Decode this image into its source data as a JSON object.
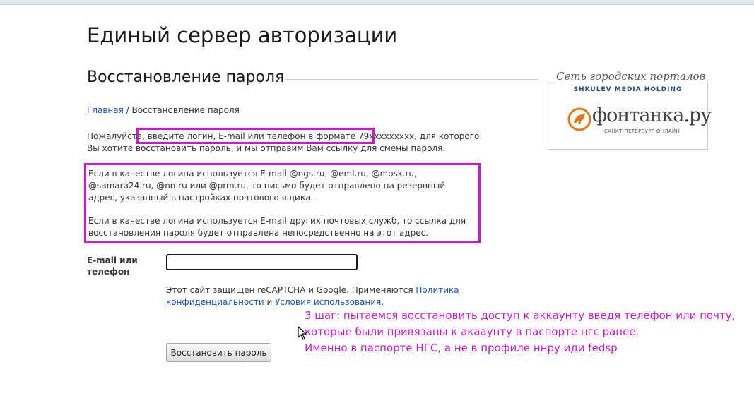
{
  "site": {
    "title": "Единый сервер авторизации"
  },
  "page": {
    "section_title": "Восстановление пароля"
  },
  "breadcrumb": {
    "home": "Главная",
    "separator": " / ",
    "current": "Восстановление пароля"
  },
  "intro": {
    "before": "Пожалуйста, ",
    "highlight": "введите логин, E-mail или телефон в формате 79xxxxxxxxx,",
    "after": " для которого Вы хотите восстановить пароль, и мы отправим Вам ссылку для смены пароля."
  },
  "info": {
    "paragraph1": "Если в качестве логина используется E-mail @ngs.ru, @eml.ru, @mosk.ru, @samara24.ru, @nn.ru или @prm.ru, то письмо будет отправлено на резервный адрес, указанный в настройках почтового ящика.",
    "paragraph2": "Если в качестве логина используется E-mail других почтовых служб, то ссылка для восстановления пароля будет отправлена непосредственно на этот адрес."
  },
  "form": {
    "label": "E-mail или телефон",
    "value": "",
    "placeholder": "",
    "recaptcha_before": "Этот сайт защищен reCAPTCHA и Google. Применяются ",
    "privacy_link": "Политика конфиденциальности",
    "recaptcha_and": " и ",
    "terms_link": "Условия использования",
    "recaptcha_end": ".",
    "submit": "Восстановить пароль"
  },
  "annotation": {
    "line1": "3 шаг: пытаемся восстановить доступ к аккаунту введя телефон или почту,",
    "line2": "которые были привязаны к акааунту в паспорте нгс ранее.",
    "line3": "Именно в паспорте НГС, а не в профиле ннру иди fedsp"
  },
  "logo": {
    "tagline": "Сеть городских порталов",
    "holding": "SHKULEV MEDIA HOLDING",
    "name": "фонтанка.ру",
    "city": "САНКТ-ПЕТЕРБУРГ ОНЛАЙН"
  },
  "colors": {
    "annotation": "#c81bd0",
    "link": "#1f4fb4",
    "logo_accent": "#e07a1c"
  },
  "icons": {
    "cursor": "mouse-pointer-icon",
    "logo_mark": "fontanka-horse-icon"
  }
}
